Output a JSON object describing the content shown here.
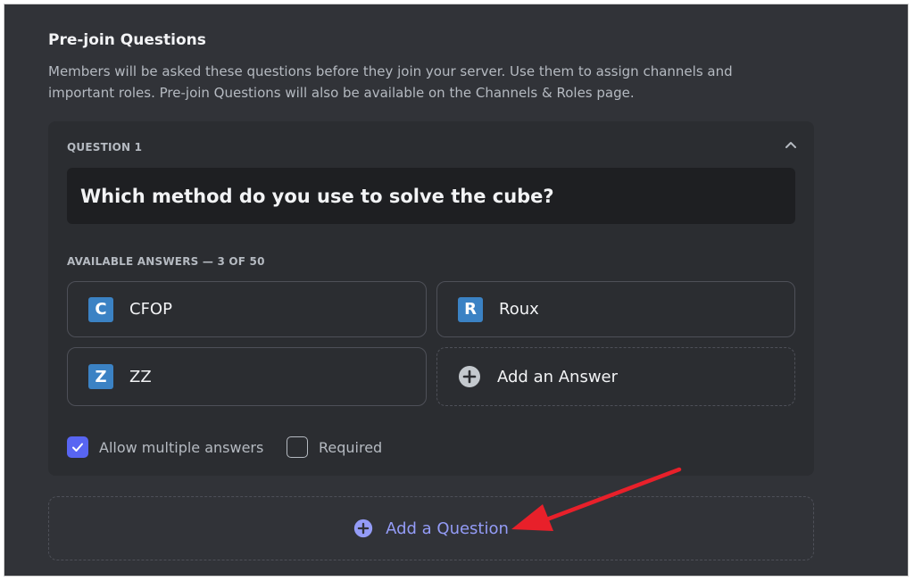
{
  "colors": {
    "background": "#313338",
    "card": "#2b2d31",
    "input": "#1e1f22",
    "accent": "#5865f2",
    "link": "#949cf7",
    "badge": "#3b82c4",
    "annotation_arrow": "#e8202a"
  },
  "section": {
    "title": "Pre-join Questions",
    "description": "Members will be asked these questions before they join your server. Use them to assign channels and important roles. Pre-join Questions will also be available on the Channels & Roles page."
  },
  "question": {
    "label": "QUESTION 1",
    "collapse_icon": "chevron-up-icon",
    "text": "Which method do you use to solve the cube?",
    "answers_label": "AVAILABLE ANSWERS — 3 OF 50",
    "answers": [
      {
        "badge": "C",
        "label": "CFOP"
      },
      {
        "badge": "R",
        "label": "Roux"
      },
      {
        "badge": "Z",
        "label": "ZZ"
      }
    ],
    "add_answer_label": "Add an Answer",
    "add_answer_icon": "plus-circle-icon",
    "options": {
      "allow_multiple": {
        "label": "Allow multiple answers",
        "checked": true
      },
      "required": {
        "label": "Required",
        "checked": false
      }
    }
  },
  "add_question": {
    "label": "Add a Question",
    "icon": "plus-circle-icon"
  }
}
